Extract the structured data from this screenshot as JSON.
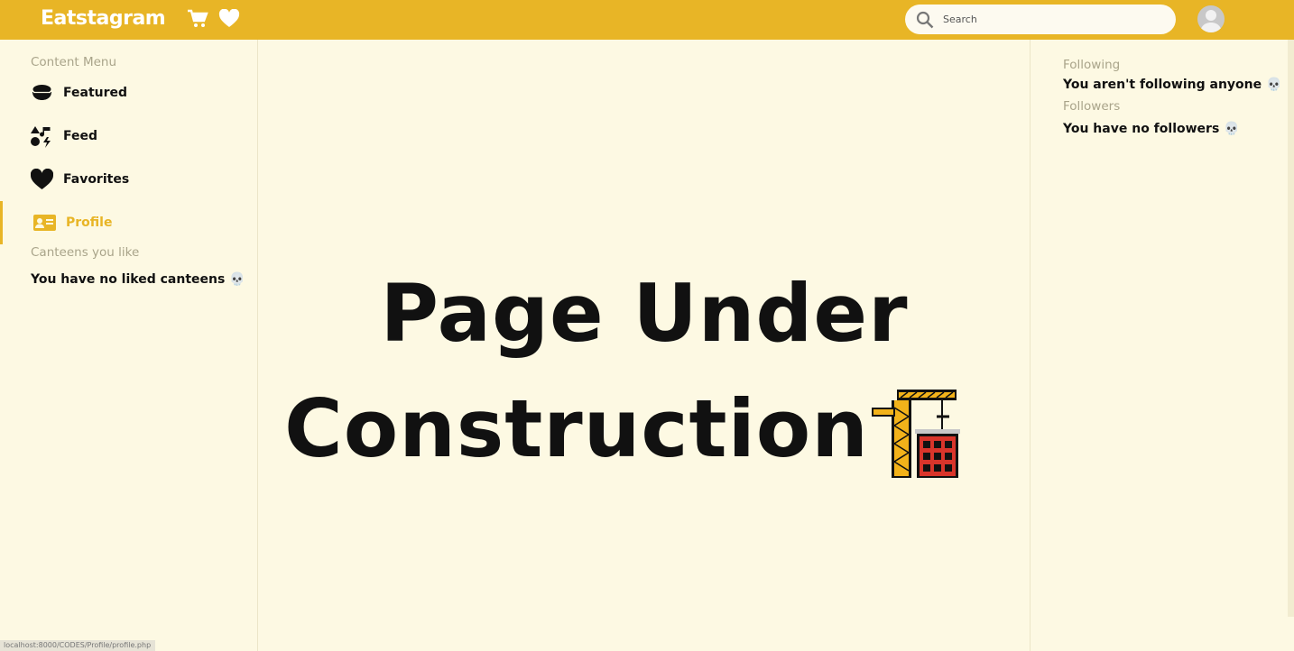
{
  "header": {
    "logo": "Eatstagram",
    "icons": [
      "cart-icon",
      "heart-icon"
    ],
    "search": {
      "placeholder": "Search",
      "value": ""
    },
    "avatar_icon": "user-avatar-icon"
  },
  "sidebar": {
    "menu_title": "Content Menu",
    "items": [
      {
        "label": "Featured",
        "icon": "bowl-icon",
        "active": false
      },
      {
        "label": "Feed",
        "icon": "feed-icon",
        "active": false
      },
      {
        "label": "Favorites",
        "icon": "heart-icon",
        "active": false
      },
      {
        "label": "Profile",
        "icon": "id-card-icon",
        "active": true
      }
    ],
    "liked_title": "Canteens you like",
    "liked_empty": "You have no liked canteens 💀"
  },
  "right_panel": {
    "following_title": "Following",
    "following_empty": "You aren't following anyone 💀",
    "followers_title": "Followers",
    "followers_empty": "You have no followers 💀"
  },
  "main": {
    "title_line1": "Page Under",
    "title_line2": "Construction",
    "emoji_icon": "construction-crane-icon"
  },
  "status_bar": {
    "url": "localhost:8000/CODES/Profile/profile.php"
  },
  "colors": {
    "accent": "#e8b526",
    "background": "#fdf9e3",
    "muted": "#a9a48a"
  }
}
